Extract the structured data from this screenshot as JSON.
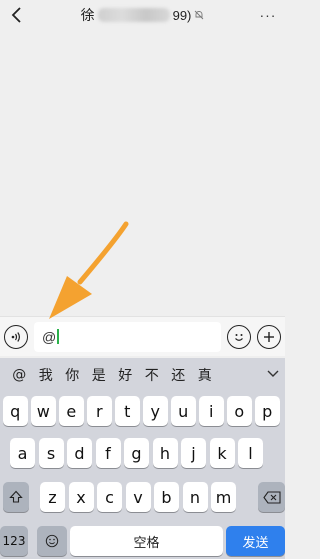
{
  "header": {
    "title_first_char": "徐",
    "title_tail": "99)",
    "more_label": "···"
  },
  "input": {
    "value": "@"
  },
  "candidates": [
    "@",
    "我",
    "你",
    "是",
    "好",
    "不",
    "还",
    "真"
  ],
  "keyboard": {
    "row1": [
      "q",
      "w",
      "e",
      "r",
      "t",
      "y",
      "u",
      "i",
      "o",
      "p"
    ],
    "row2": [
      "a",
      "s",
      "d",
      "f",
      "g",
      "h",
      "j",
      "k",
      "l"
    ],
    "row3": [
      "z",
      "x",
      "c",
      "v",
      "b",
      "n",
      "m"
    ],
    "numbers_label": "123",
    "space_label": "空格",
    "send_label": "发送"
  },
  "colors": {
    "accent_green": "#2bb24c",
    "send_blue": "#2f80ed",
    "arrow_orange": "#f4a230"
  }
}
